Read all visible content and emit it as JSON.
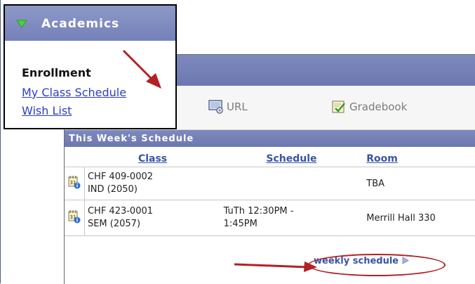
{
  "callout": {
    "section_title": "Academics",
    "group_title": "Enrollment",
    "links": [
      "My Class Schedule",
      "Wish List"
    ]
  },
  "toolbar": {
    "url_label": "URL",
    "gradebook_label": "Gradebook"
  },
  "schedule": {
    "header": "This Week's Schedule",
    "columns": [
      "Class",
      "Schedule",
      "Room"
    ],
    "rows": [
      {
        "class_line1": "CHF 409-0002",
        "class_line2": "IND (2050)",
        "schedule_line1": "",
        "schedule_line2": "",
        "room": "TBA"
      },
      {
        "class_line1": "CHF 423-0001",
        "class_line2": "SEM (2057)",
        "schedule_line1": "TuTh 12:30PM -",
        "schedule_line2": "1:45PM",
        "room": "Merrill Hall 330"
      }
    ],
    "weekly_link": "weekly schedule"
  },
  "colors": {
    "header_blue": "#6c78b0",
    "link_blue": "#3954a6",
    "annotation_red": "#b32025"
  }
}
